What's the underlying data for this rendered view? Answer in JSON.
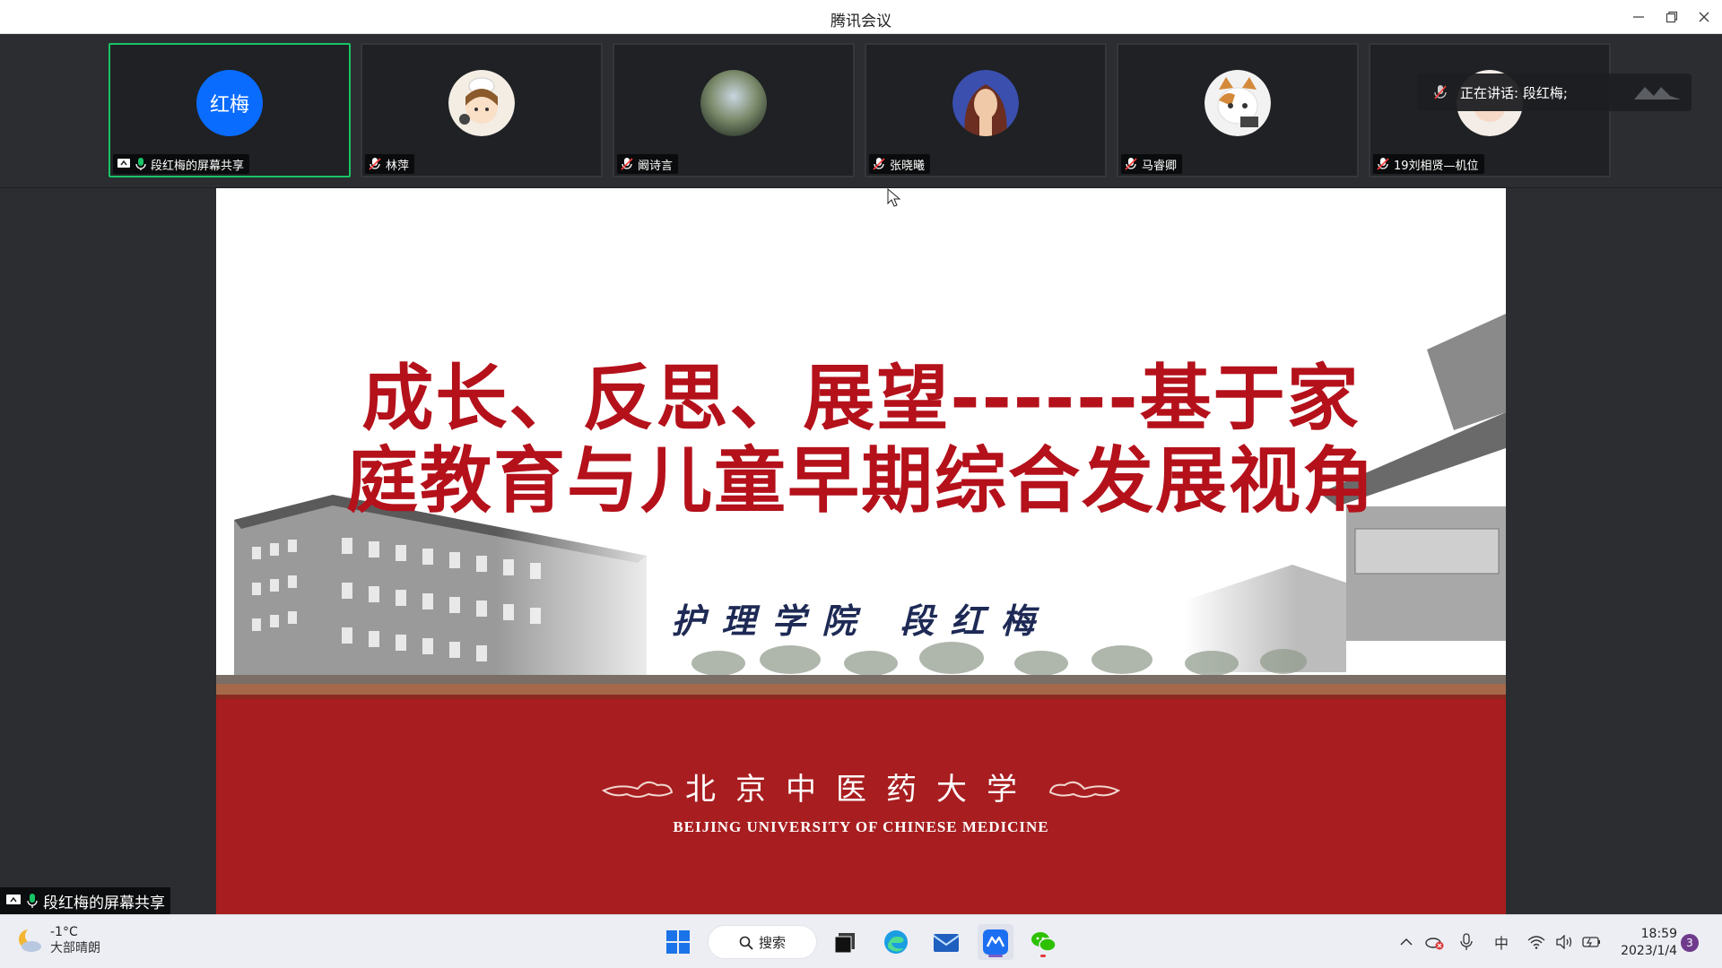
{
  "window": {
    "title": "腾讯会议"
  },
  "participants": [
    {
      "name": "段红梅的屏幕共享",
      "avatar_text": "红梅",
      "active": true,
      "sharing": true
    },
    {
      "name": "林萍",
      "avatar_text": "",
      "active": false
    },
    {
      "name": "阚诗言",
      "avatar_text": "",
      "active": false
    },
    {
      "name": "张晓曦",
      "avatar_text": "",
      "active": false
    },
    {
      "name": "马睿卿",
      "avatar_text": "",
      "active": false
    },
    {
      "name": "19刘相贤—机位",
      "avatar_text": "",
      "active": false
    }
  ],
  "speaking_banner": {
    "text": "正在讲话: 段红梅;"
  },
  "slide": {
    "title_line1": "成长、反思、展望------基于家",
    "title_line2": "庭教育与儿童早期综合发展视角",
    "author": "护理学院  段红梅",
    "university_cn": "北京中医药大学",
    "university_en": "BEIJING UNIVERSITY OF CHINESE MEDICINE",
    "colors": {
      "title": "#b4111b",
      "band": "#a81e20",
      "author": "#1e2a55"
    }
  },
  "share_label": "段红梅的屏幕共享",
  "taskbar": {
    "weather_temp": "-1°C",
    "weather_cond": "大部晴朗",
    "search_label": "搜索",
    "input_method": "中",
    "time": "18:59",
    "date": "2023/1/4",
    "notification_count": "3",
    "apps": [
      "windows-start",
      "search",
      "task-view",
      "edge",
      "mail",
      "tencent-meeting",
      "wechat"
    ]
  }
}
